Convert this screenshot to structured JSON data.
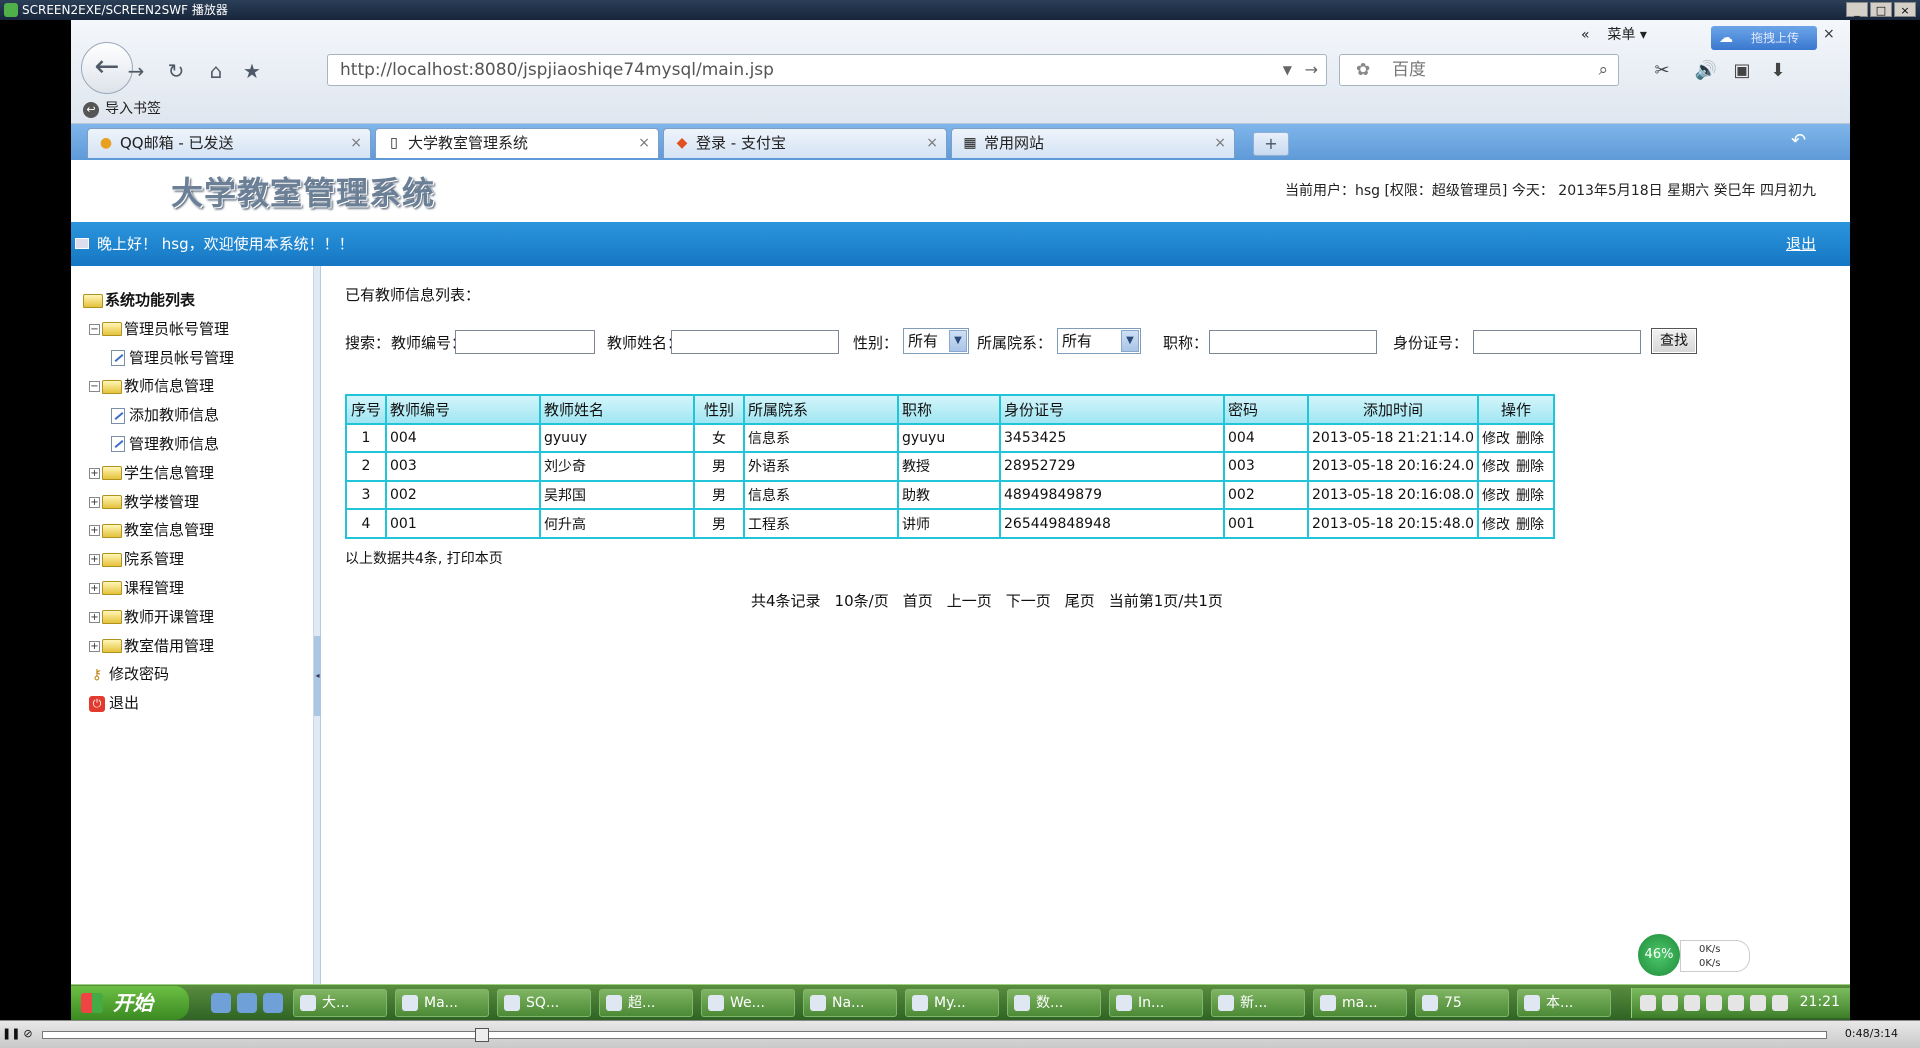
{
  "player": {
    "title": "SCREEN2EXE/SCREEN2SWF 播放器",
    "time": "0:48/3:14"
  },
  "browser": {
    "url": "http://localhost:8080/jspjiaoshiqe74mysql/main.jsp",
    "search_placeholder": "百度",
    "menu_label": "菜单",
    "upload_label": "拖拽上传",
    "bookmarks_label": "导入书签",
    "tabs": [
      {
        "label": "QQ邮箱 - 已发送",
        "icon": "qq-mail-icon"
      },
      {
        "label": "大学教室管理系统",
        "icon": "page-icon"
      },
      {
        "label": "登录 - 支付宝",
        "icon": "alipay-icon"
      },
      {
        "label": "常用网站",
        "icon": "grid-icon"
      }
    ]
  },
  "header": {
    "system_title": "大学教室管理系统",
    "user_info": "当前用户：hsg [权限：超级管理员] 今天： 2013年5月18日 星期六 癸巳年 四月初九",
    "greeting": "晚上好！ hsg，欢迎使用本系统！！！",
    "logout": "退出"
  },
  "sidebar": {
    "items": [
      {
        "label": "系统功能列表",
        "level": 0,
        "type": "root"
      },
      {
        "label": "管理员帐号管理",
        "level": 1,
        "type": "folder",
        "expanded": true
      },
      {
        "label": "管理员帐号管理",
        "level": 2,
        "type": "page"
      },
      {
        "label": "教师信息管理",
        "level": 1,
        "type": "folder",
        "expanded": true
      },
      {
        "label": "添加教师信息",
        "level": 2,
        "type": "page"
      },
      {
        "label": "管理教师信息",
        "level": 2,
        "type": "page"
      },
      {
        "label": "学生信息管理",
        "level": 1,
        "type": "folder",
        "expanded": false
      },
      {
        "label": "教学楼管理",
        "level": 1,
        "type": "folder",
        "expanded": false
      },
      {
        "label": "教室信息管理",
        "level": 1,
        "type": "folder",
        "expanded": false
      },
      {
        "label": "院系管理",
        "level": 1,
        "type": "folder",
        "expanded": false
      },
      {
        "label": "课程管理",
        "level": 1,
        "type": "folder",
        "expanded": false
      },
      {
        "label": "教师开课管理",
        "level": 1,
        "type": "folder",
        "expanded": false
      },
      {
        "label": "教室借用管理",
        "level": 1,
        "type": "folder",
        "expanded": false
      },
      {
        "label": "修改密码",
        "level": 1,
        "type": "key"
      },
      {
        "label": "退出",
        "level": 1,
        "type": "exit"
      }
    ]
  },
  "content": {
    "list_title": "已有教师信息列表：",
    "search": {
      "label": "搜索：",
      "teacher_no_label": "教师编号：",
      "teacher_name_label": "教师姓名：",
      "gender_label": "性别：",
      "gender_value": "所有",
      "dept_label": "所属院系：",
      "dept_value": "所有",
      "title_label": "职称：",
      "id_label": "身份证号：",
      "button": "查找"
    },
    "table": {
      "headers": [
        "序号",
        "教师编号",
        "教师姓名",
        "性别",
        "所属院系",
        "职称",
        "身份证号",
        "密码",
        "添加时间",
        "操作"
      ],
      "rows": [
        [
          "1",
          "004",
          "gyuuy",
          "女",
          "信息系",
          "gyuyu",
          "3453425",
          "004",
          "2013-05-18 21:21:14.0"
        ],
        [
          "2",
          "003",
          "刘少奇",
          "男",
          "外语系",
          "教授",
          "28952729",
          "003",
          "2013-05-18 20:16:24.0"
        ],
        [
          "3",
          "002",
          "吴邦国",
          "男",
          "信息系",
          "助教",
          "48949849879",
          "002",
          "2013-05-18 20:16:08.0"
        ],
        [
          "4",
          "001",
          "何升高",
          "男",
          "工程系",
          "讲师",
          "265449848948",
          "001",
          "2013-05-18 20:15:48.0"
        ]
      ],
      "edit_label": "修改",
      "delete_label": "删除"
    },
    "summary": "以上数据共4条, 打印本页",
    "pager": [
      "共4条记录",
      "10条/页",
      "首页",
      "上一页",
      "下一页",
      "尾页",
      "当前第1页/共1页"
    ]
  },
  "taskbar": {
    "start_label": "开始",
    "items": [
      "大...",
      "Ma...",
      "SQ...",
      "超...",
      "We...",
      "Na...",
      "My...",
      "数...",
      "In...",
      "新...",
      "ma...",
      "75",
      "本..."
    ],
    "clock": "21:21",
    "speed_percent": "46%",
    "up_speed": "0K/s",
    "down_speed": "0K/s"
  }
}
